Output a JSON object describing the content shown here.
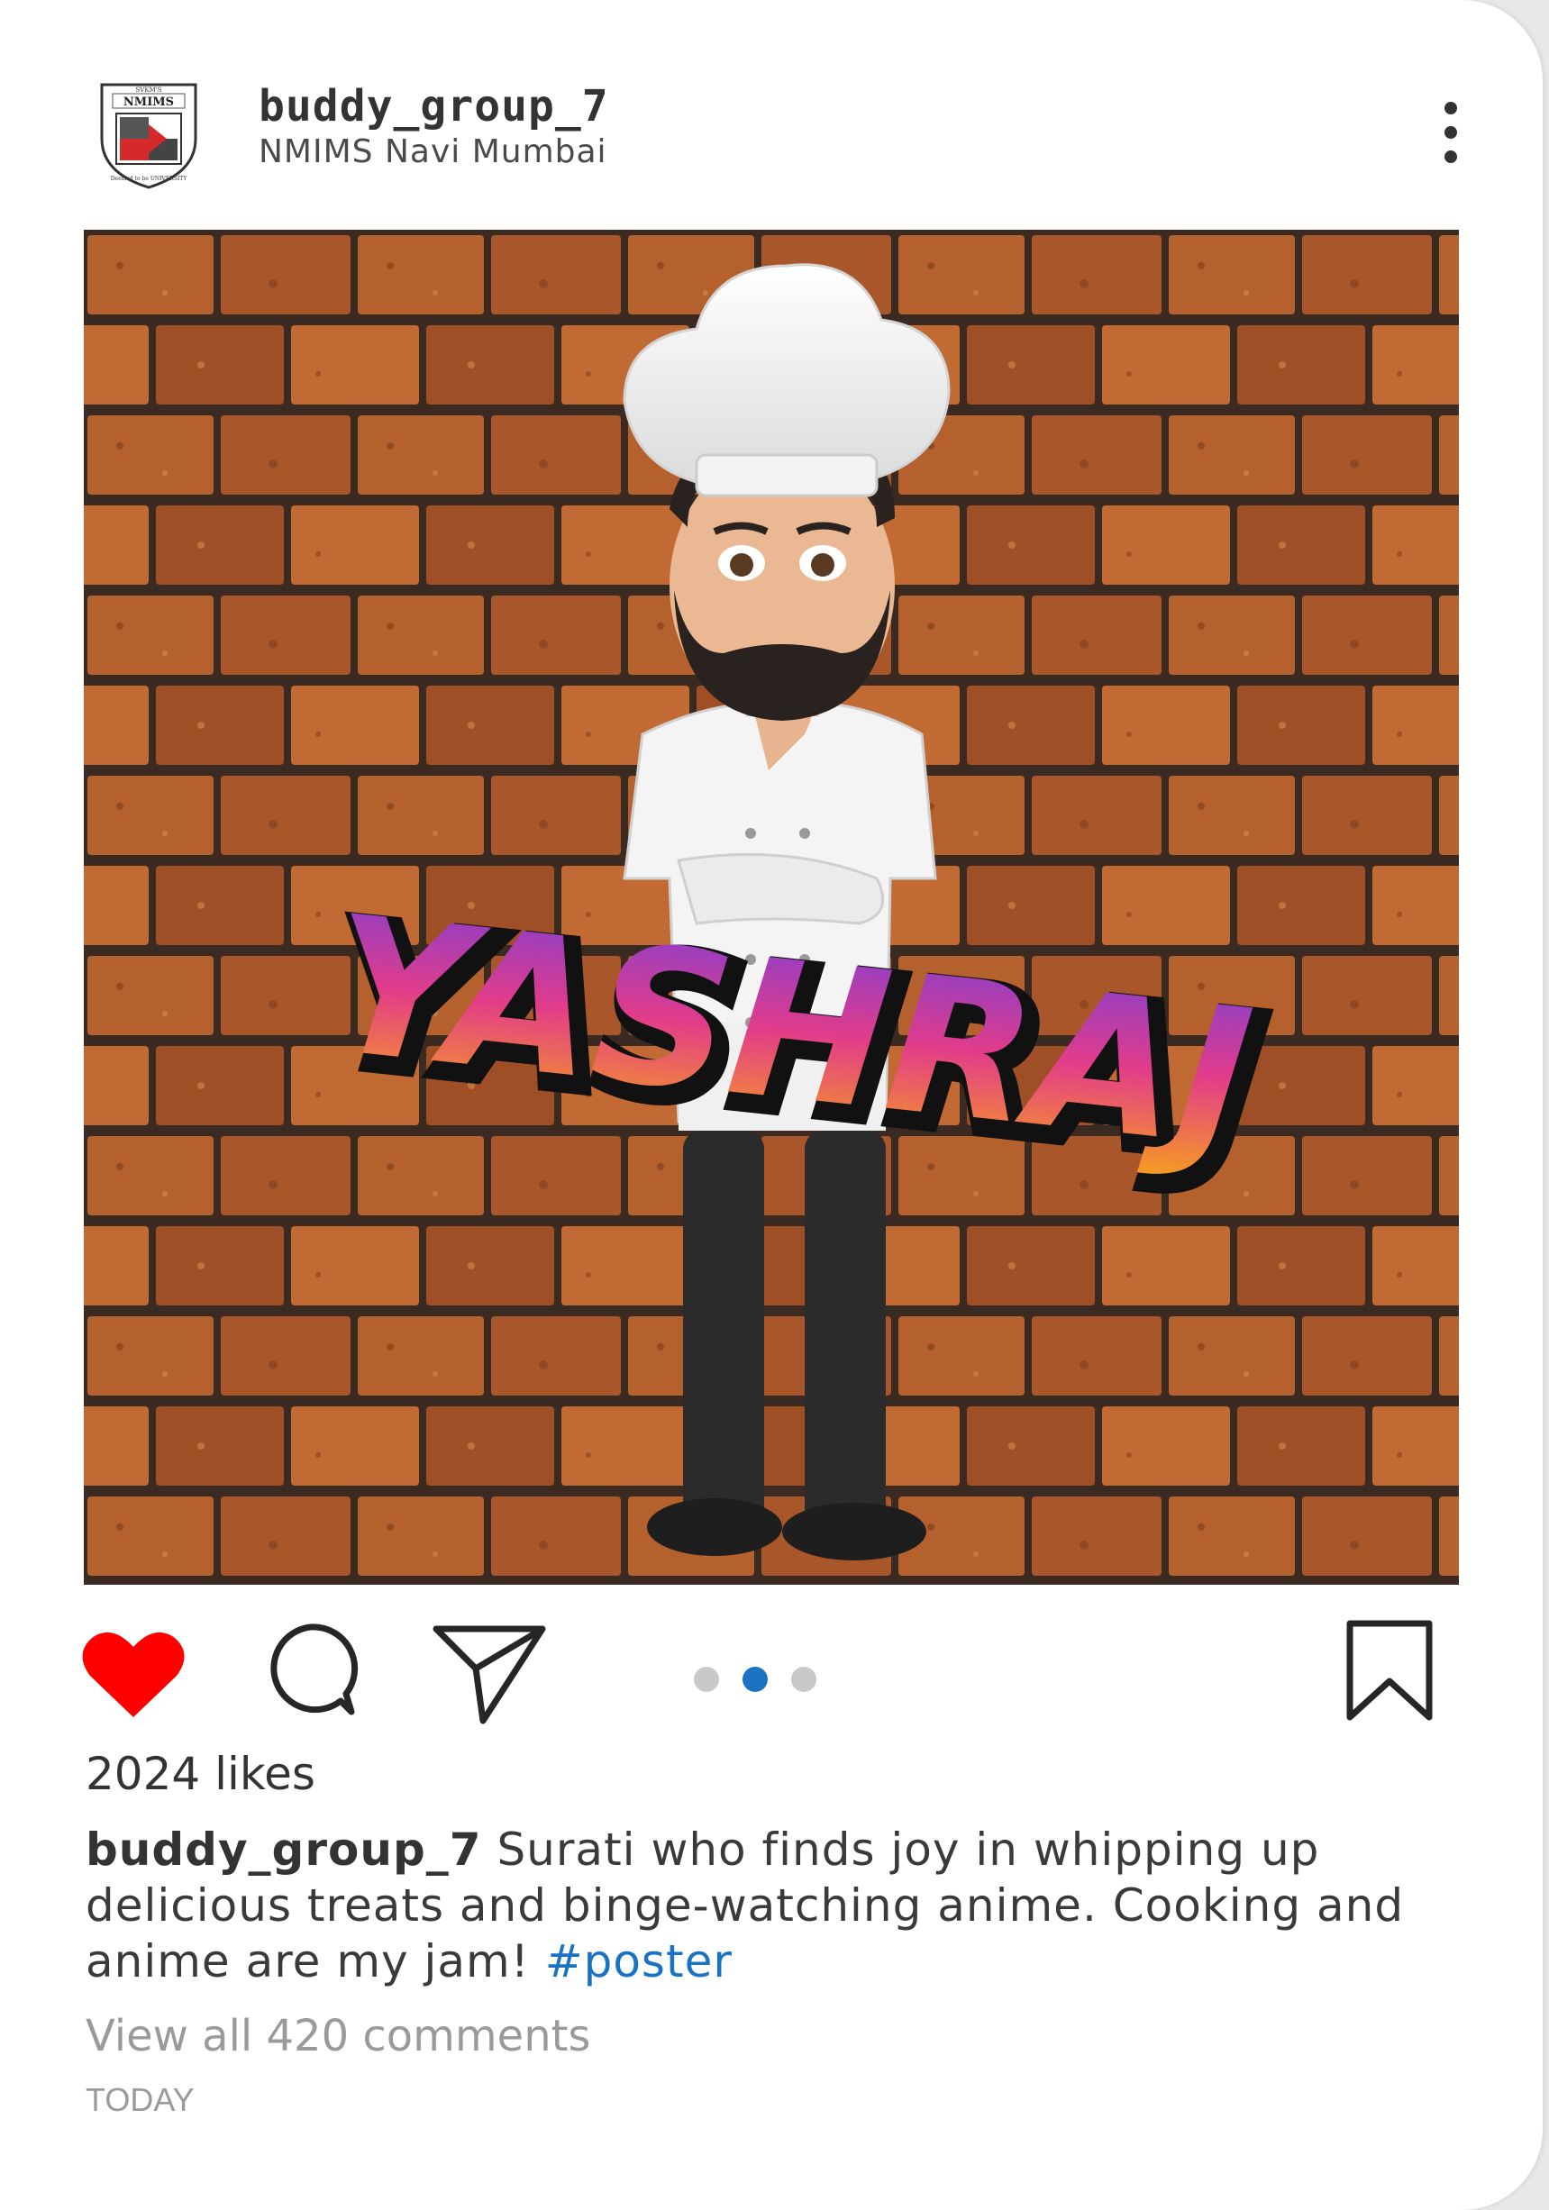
{
  "post": {
    "username": "buddy_group_7",
    "location": "NMIMS Navi Mumbai",
    "logo_text_top": "NMIMS",
    "logo_text_small": "SVKM'S",
    "logo_text_bottom": "Deemed to be UNIVERSITY",
    "photo_overlay_text": "YASHRAJ",
    "likes_text": "2024 likes",
    "caption_user": "buddy_group_7",
    "caption_text": " Surati who finds joy in whipping up delicious treats and binge-watching anime. Cooking and anime are my jam! ",
    "hashtag": "#poster",
    "comments_text": "View all 420 comments",
    "timestamp": "TODAY"
  },
  "carousel": {
    "count": 3,
    "active_index": 1
  },
  "icons": {
    "more": "more-vertical-icon",
    "like": "heart-icon",
    "comment": "comment-icon",
    "share": "send-icon",
    "save": "bookmark-icon"
  },
  "colors": {
    "heart": "#ff0000",
    "link": "#1a73c2",
    "brick": "#b5612e",
    "mortar": "#3b2a22"
  }
}
